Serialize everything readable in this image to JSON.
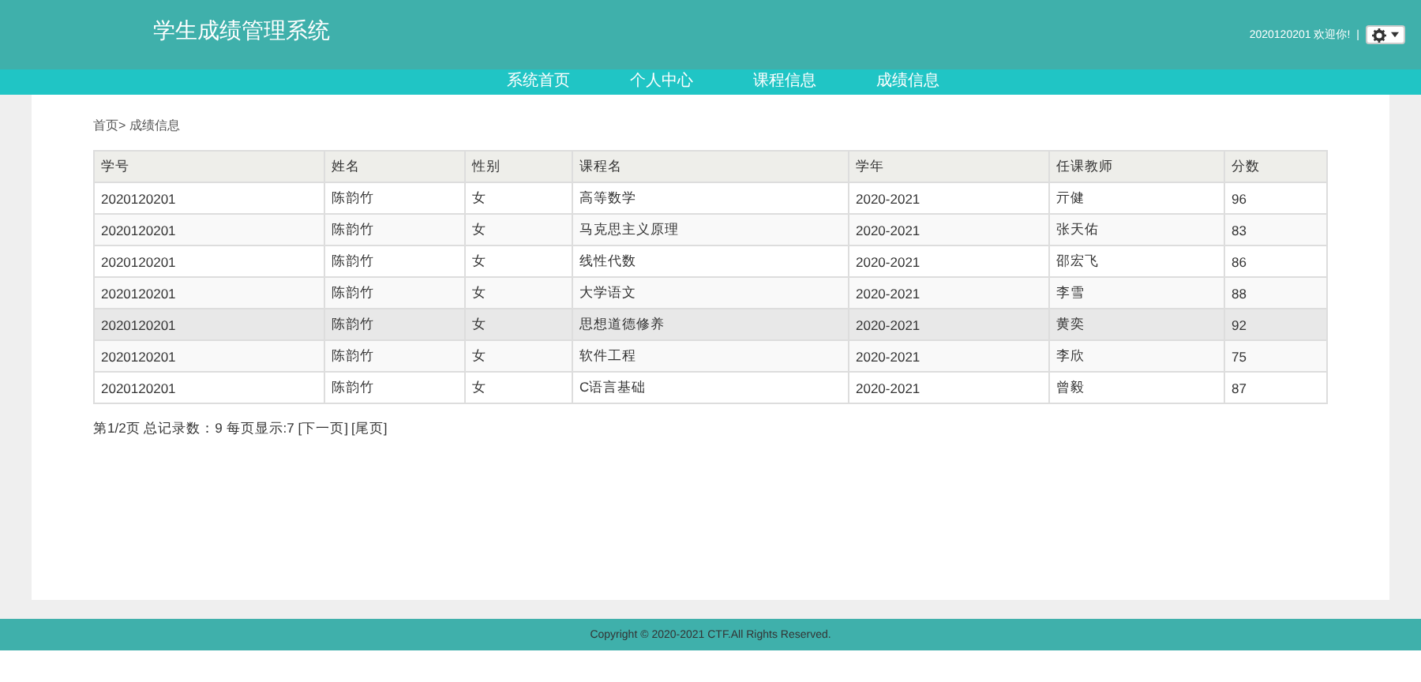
{
  "header": {
    "title": "学生成绩管理系统",
    "user_text": "2020120201 欢迎你!",
    "separator": "|"
  },
  "nav": [
    {
      "label": "系统首页"
    },
    {
      "label": "个人中心"
    },
    {
      "label": "课程信息"
    },
    {
      "label": "成绩信息"
    }
  ],
  "breadcrumb": "首页> 成绩信息",
  "table": {
    "columns": [
      "学号",
      "姓名",
      "性别",
      "课程名",
      "学年",
      "任课教师",
      "分数"
    ],
    "rows": [
      {
        "cells": [
          "2020120201",
          "陈韵竹",
          "女",
          "高等数学",
          "2020-2021",
          "亓健",
          "96"
        ],
        "highlighted": false
      },
      {
        "cells": [
          "2020120201",
          "陈韵竹",
          "女",
          "马克思主义原理",
          "2020-2021",
          "张天佑",
          "83"
        ],
        "highlighted": false
      },
      {
        "cells": [
          "2020120201",
          "陈韵竹",
          "女",
          "线性代数",
          "2020-2021",
          "邵宏飞",
          "86"
        ],
        "highlighted": false
      },
      {
        "cells": [
          "2020120201",
          "陈韵竹",
          "女",
          "大学语文",
          "2020-2021",
          "李雪",
          "88"
        ],
        "highlighted": false
      },
      {
        "cells": [
          "2020120201",
          "陈韵竹",
          "女",
          "思想道德修养",
          "2020-2021",
          "黄奕",
          "92"
        ],
        "highlighted": true
      },
      {
        "cells": [
          "2020120201",
          "陈韵竹",
          "女",
          "软件工程",
          "2020-2021",
          "李欣",
          "75"
        ],
        "highlighted": false
      },
      {
        "cells": [
          "2020120201",
          "陈韵竹",
          "女",
          "C语言基础",
          "2020-2021",
          "曾毅",
          "87"
        ],
        "highlighted": false
      }
    ]
  },
  "pagination": {
    "summary": "第1/2页 总记录数：9 每页显示:7",
    "links": [
      "[下一页]",
      "[尾页]"
    ]
  },
  "footer": "Copyright © 2020-2021 CTF.All Rights Reserved."
}
